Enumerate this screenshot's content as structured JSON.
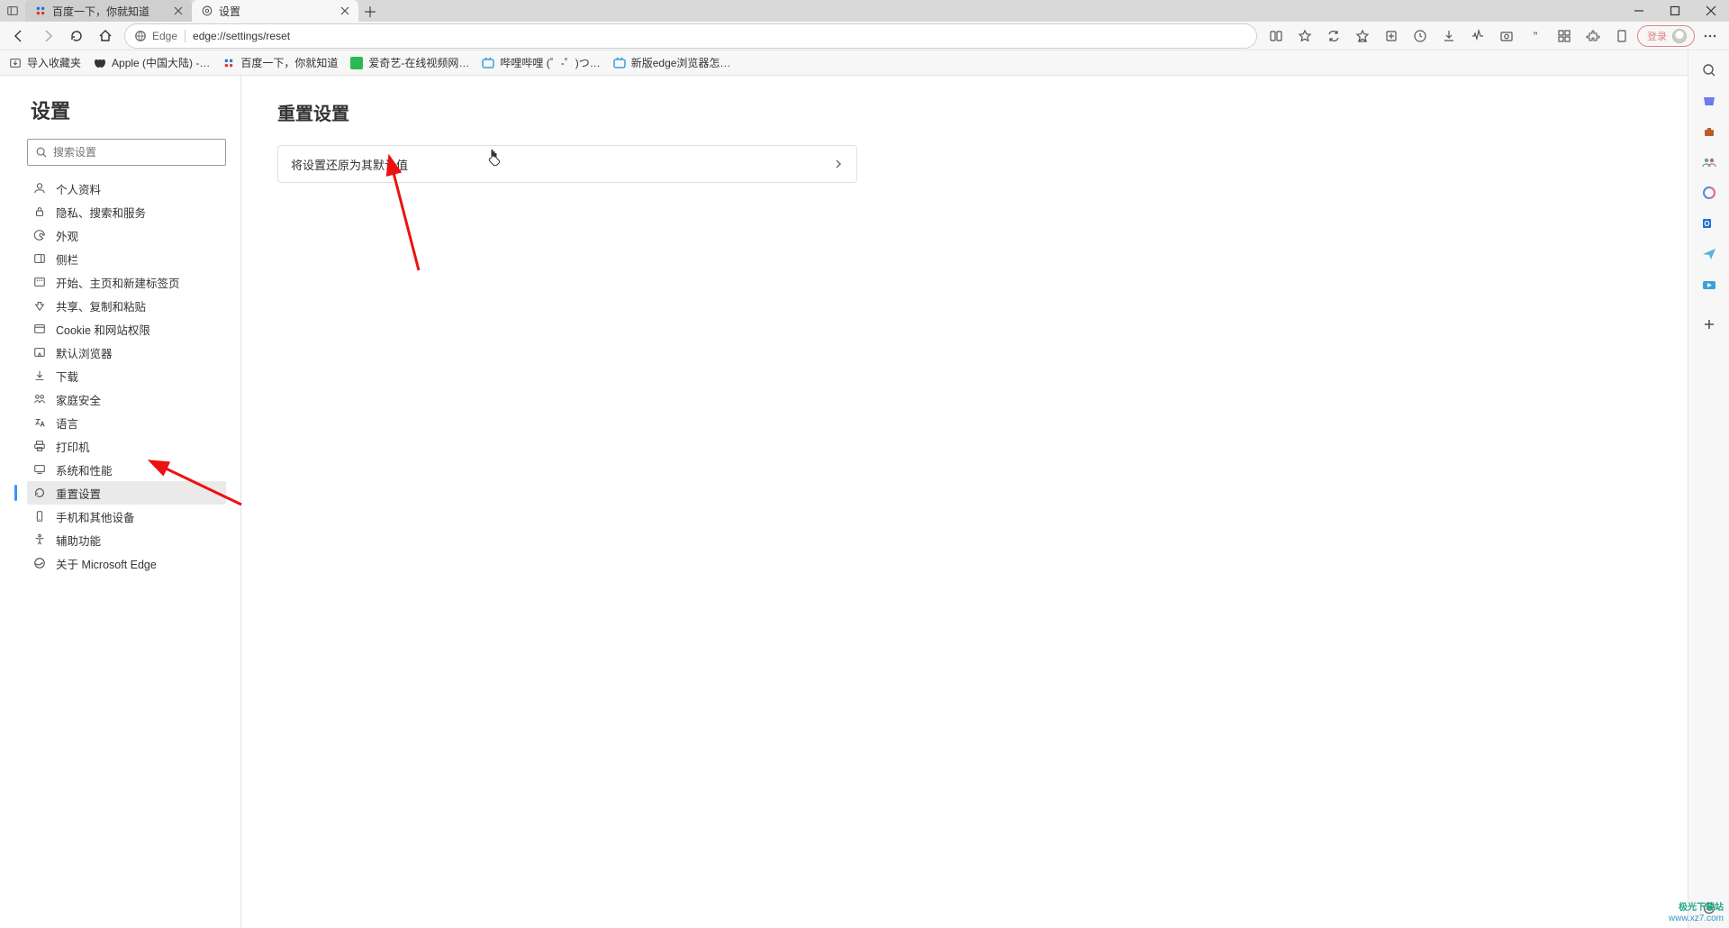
{
  "window": {
    "tabs": [
      {
        "title": "百度一下，你就知道",
        "active": false
      },
      {
        "title": "设置",
        "active": true
      }
    ]
  },
  "toolbar": {
    "site_label": "Edge",
    "url": "edge://settings/reset",
    "login_label": "登录"
  },
  "bookmarks": {
    "import_label": "导入收藏夹",
    "items": [
      {
        "label": "Apple (中国大陆) -…"
      },
      {
        "label": "百度一下，你就知道"
      },
      {
        "label": "爱奇艺-在线视频网…"
      },
      {
        "label": "哔哩哔哩 (゜-゜)つ…"
      },
      {
        "label": "新版edge浏览器怎…"
      }
    ]
  },
  "sidebar": {
    "title": "设置",
    "search_placeholder": "搜索设置",
    "items": [
      {
        "label": "个人资料"
      },
      {
        "label": "隐私、搜索和服务"
      },
      {
        "label": "外观"
      },
      {
        "label": "侧栏"
      },
      {
        "label": "开始、主页和新建标签页"
      },
      {
        "label": "共享、复制和粘贴"
      },
      {
        "label": "Cookie 和网站权限"
      },
      {
        "label": "默认浏览器"
      },
      {
        "label": "下载"
      },
      {
        "label": "家庭安全"
      },
      {
        "label": "语言"
      },
      {
        "label": "打印机"
      },
      {
        "label": "系统和性能"
      },
      {
        "label": "重置设置"
      },
      {
        "label": "手机和其他设备"
      },
      {
        "label": "辅助功能"
      },
      {
        "label": "关于 Microsoft Edge"
      }
    ],
    "active_index": 13
  },
  "content": {
    "title": "重置设置",
    "row_label": "将设置还原为其默认值"
  },
  "watermark": {
    "line1": "极光下载站",
    "line2": "www.xz7.com"
  }
}
